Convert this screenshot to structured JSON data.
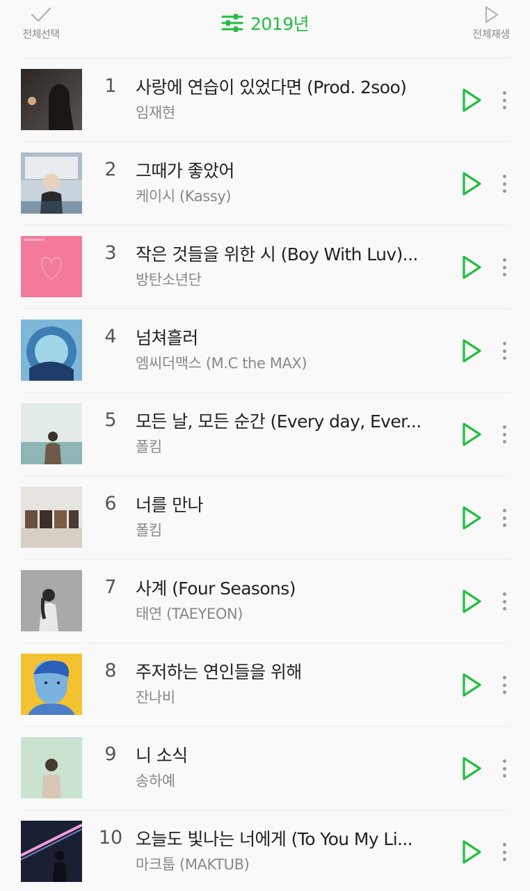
{
  "header": {
    "select_all_label": "전체선택",
    "year_label": "2019년",
    "play_all_label": "전체재생"
  },
  "colors": {
    "accent": "#1fbf3e",
    "text_primary": "#222222",
    "text_secondary": "#888888",
    "background": "#f9f9f9"
  },
  "songs": [
    {
      "rank": "1",
      "title": "사랑에 연습이 있었다면 (Prod. 2soo)",
      "artist": "임재현"
    },
    {
      "rank": "2",
      "title": "그때가 좋았어",
      "artist": "케이시 (Kassy)"
    },
    {
      "rank": "3",
      "title": "작은 것들을 위한 시 (Boy With Luv)...",
      "artist": "방탄소년단"
    },
    {
      "rank": "4",
      "title": "넘쳐흘러",
      "artist": "엠씨더맥스 (M.C the MAX)"
    },
    {
      "rank": "5",
      "title": "모든 날, 모든 순간 (Every day, Ever...",
      "artist": "폴킴"
    },
    {
      "rank": "6",
      "title": "너를 만나",
      "artist": "폴킴"
    },
    {
      "rank": "7",
      "title": "사계 (Four Seasons)",
      "artist": "태연 (TAEYEON)"
    },
    {
      "rank": "8",
      "title": "주저하는 연인들을 위해",
      "artist": "잔나비"
    },
    {
      "rank": "9",
      "title": "니 소식",
      "artist": "송하예"
    },
    {
      "rank": "10",
      "title": "오늘도 빛나는 너에게 (To You My Li...",
      "artist": "마크툽 (MAKTUB)"
    }
  ]
}
